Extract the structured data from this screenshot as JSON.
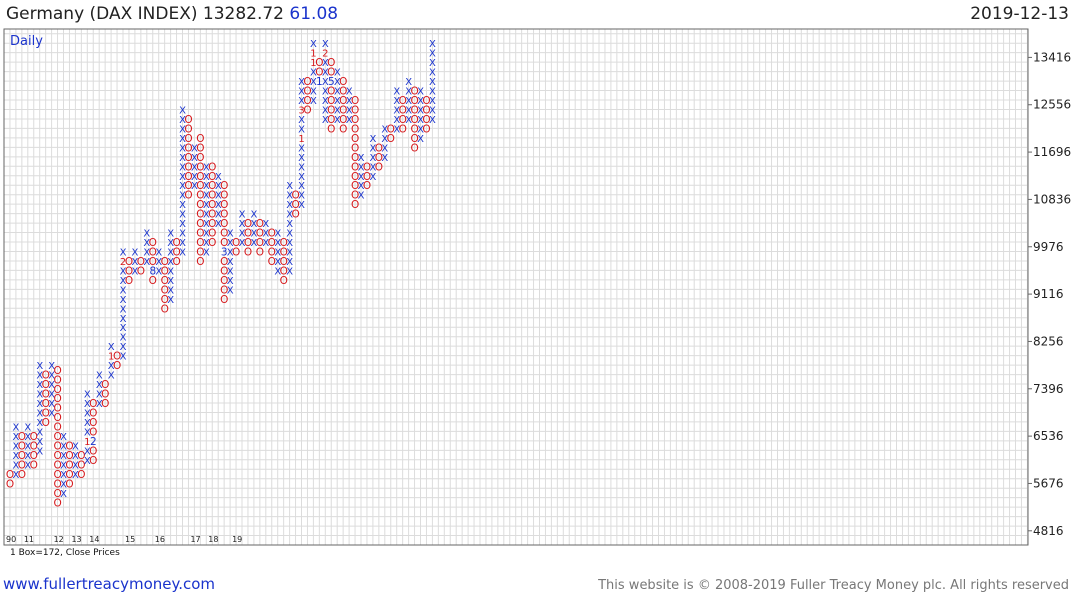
{
  "header": {
    "title": "Germany (DAX INDEX) 13282.72",
    "change": "61.08",
    "date": "2019-12-13"
  },
  "chart_label": "Daily",
  "box_note": "1 Box=172, Close Prices",
  "footer": {
    "link": "www.fullertreacymoney.com",
    "copyright": "This website is © 2008-2019 Fuller Treacy Money plc. All rights reserved"
  },
  "chart_data": {
    "type": "point-and-figure",
    "box_size": 172,
    "price_basis": "Close Prices",
    "y_ticks": [
      4816,
      5676,
      6536,
      7396,
      8256,
      9116,
      9976,
      10836,
      11696,
      12556,
      13416
    ],
    "ylim": [
      4558,
      13932
    ],
    "grid": true,
    "x_labels": [
      {
        "label": "90",
        "col": 0
      },
      {
        "label": "11",
        "col": 3
      },
      {
        "label": "12",
        "col": 8
      },
      {
        "label": "13",
        "col": 11
      },
      {
        "label": "14",
        "col": 14
      },
      {
        "label": "15",
        "col": 20
      },
      {
        "label": "16",
        "col": 25
      },
      {
        "label": "17",
        "col": 31
      },
      {
        "label": "18",
        "col": 34
      },
      {
        "label": "19",
        "col": 38
      }
    ],
    "columns": [
      {
        "t": "O",
        "lo": 5590,
        "hi": 5762
      },
      {
        "t": "X",
        "lo": 5762,
        "hi": 6536,
        "m": {
          "6536": "4"
        }
      },
      {
        "t": "O",
        "lo": 5762,
        "hi": 6364
      },
      {
        "t": "X",
        "lo": 5934,
        "hi": 6536
      },
      {
        "t": "O",
        "lo": 5934,
        "hi": 6364
      },
      {
        "t": "X",
        "lo": 6192,
        "hi": 7740
      },
      {
        "t": "O",
        "lo": 6708,
        "hi": 7568
      },
      {
        "t": "X",
        "lo": 6880,
        "hi": 7740
      },
      {
        "t": "O",
        "lo": 5246,
        "hi": 7568,
        "m": {
          "7568": "8"
        }
      },
      {
        "t": "X",
        "lo": 5418,
        "hi": 6364
      },
      {
        "t": "O",
        "lo": 5590,
        "hi": 6192
      },
      {
        "t": "X",
        "lo": 5762,
        "hi": 6192
      },
      {
        "t": "O",
        "lo": 5762,
        "hi": 6020
      },
      {
        "t": "X",
        "lo": 6020,
        "hi": 7224,
        "m": {
          "6364": "1"
        }
      },
      {
        "t": "O",
        "lo": 6020,
        "hi": 7052,
        "m": {
          "6364": "2"
        }
      },
      {
        "t": "X",
        "lo": 7052,
        "hi": 7568
      },
      {
        "t": "O",
        "lo": 7052,
        "hi": 7396
      },
      {
        "t": "X",
        "lo": 7568,
        "hi": 8084,
        "m": {
          "7912": "1"
        }
      },
      {
        "t": "O",
        "lo": 7740,
        "hi": 7912
      },
      {
        "t": "X",
        "lo": 7912,
        "hi": 9804,
        "m": {
          "9632": "2"
        }
      },
      {
        "t": "O",
        "lo": 9288,
        "hi": 9632
      },
      {
        "t": "X",
        "lo": 9460,
        "hi": 9804
      },
      {
        "t": "O",
        "lo": 9460,
        "hi": 9632
      },
      {
        "t": "X",
        "lo": 9632,
        "hi": 10148
      },
      {
        "t": "O",
        "lo": 9288,
        "hi": 9976,
        "m": {
          "9460": "8"
        }
      },
      {
        "t": "X",
        "lo": 9460,
        "hi": 9804
      },
      {
        "t": "O",
        "lo": 8772,
        "hi": 9632
      },
      {
        "t": "X",
        "lo": 8944,
        "hi": 10148
      },
      {
        "t": "O",
        "lo": 9632,
        "hi": 9976
      },
      {
        "t": "X",
        "lo": 9804,
        "hi": 12384
      },
      {
        "t": "O",
        "lo": 10836,
        "hi": 12212
      },
      {
        "t": "X",
        "lo": 11008,
        "hi": 11696
      },
      {
        "t": "O",
        "lo": 9632,
        "hi": 11868
      },
      {
        "t": "X",
        "lo": 9804,
        "hi": 11352
      },
      {
        "t": "O",
        "lo": 9976,
        "hi": 11352
      },
      {
        "t": "X",
        "lo": 10320,
        "hi": 11180
      },
      {
        "t": "O",
        "lo": 8944,
        "hi": 11008,
        "m": {
          "9804": "3"
        }
      },
      {
        "t": "X",
        "lo": 9116,
        "hi": 10148
      },
      {
        "t": "O",
        "lo": 9804,
        "hi": 9976
      },
      {
        "t": "X",
        "lo": 9976,
        "hi": 10492
      },
      {
        "t": "O",
        "lo": 9804,
        "hi": 10320
      },
      {
        "t": "X",
        "lo": 9976,
        "hi": 10492
      },
      {
        "t": "O",
        "lo": 9804,
        "hi": 10320
      },
      {
        "t": "X",
        "lo": 9976,
        "hi": 10320
      },
      {
        "t": "O",
        "lo": 9632,
        "hi": 10148
      },
      {
        "t": "X",
        "lo": 9460,
        "hi": 10148
      },
      {
        "t": "O",
        "lo": 9288,
        "hi": 9976
      },
      {
        "t": "X",
        "lo": 9460,
        "hi": 11008
      },
      {
        "t": "O",
        "lo": 10492,
        "hi": 10836
      },
      {
        "t": "X",
        "lo": 10664,
        "hi": 12900,
        "m": {
          "11868": "1",
          "12384": "3"
        }
      },
      {
        "t": "O",
        "lo": 12384,
        "hi": 12900
      },
      {
        "t": "X",
        "lo": 12556,
        "hi": 13588,
        "m": {
          "13244": "1",
          "13416": "1"
        }
      },
      {
        "t": "O",
        "lo": 12900,
        "hi": 13244,
        "m": {
          "12900": "1"
        }
      },
      {
        "t": "X",
        "lo": 12212,
        "hi": 13588,
        "m": {
          "13416": "2"
        }
      },
      {
        "t": "O",
        "lo": 12040,
        "hi": 13244,
        "m": {
          "12900": "5"
        }
      },
      {
        "t": "X",
        "lo": 12212,
        "hi": 13072
      },
      {
        "t": "O",
        "lo": 12040,
        "hi": 12900
      },
      {
        "t": "X",
        "lo": 12212,
        "hi": 12728
      },
      {
        "t": "O",
        "lo": 10664,
        "hi": 12556
      },
      {
        "t": "X",
        "lo": 10836,
        "hi": 11524
      },
      {
        "t": "O",
        "lo": 11008,
        "hi": 11352
      },
      {
        "t": "X",
        "lo": 11180,
        "hi": 11868
      },
      {
        "t": "O",
        "lo": 11352,
        "hi": 11696
      },
      {
        "t": "X",
        "lo": 11524,
        "hi": 12040
      },
      {
        "t": "O",
        "lo": 11868,
        "hi": 12040
      },
      {
        "t": "X",
        "lo": 12040,
        "hi": 12728
      },
      {
        "t": "O",
        "lo": 12040,
        "hi": 12556
      },
      {
        "t": "X",
        "lo": 12212,
        "hi": 12900
      },
      {
        "t": "O",
        "lo": 11696,
        "hi": 12728
      },
      {
        "t": "X",
        "lo": 11868,
        "hi": 12728
      },
      {
        "t": "O",
        "lo": 12040,
        "hi": 12556
      },
      {
        "t": "X",
        "lo": 12212,
        "hi": 13588
      }
    ]
  }
}
